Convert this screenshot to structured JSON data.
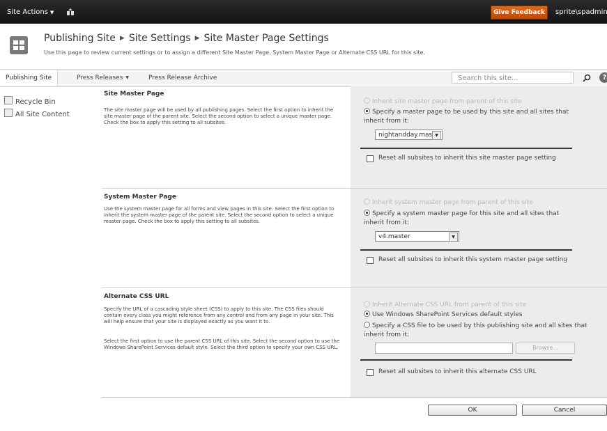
{
  "ribbon": {
    "site_actions": "Site Actions",
    "feedback_label": "Give Feedback",
    "user": "sprite\\spadmin"
  },
  "title": {
    "breadcrumb": [
      "Publishing Site",
      "Site Settings",
      "Site Master Page Settings"
    ],
    "description": "Use this page to review current settings or to assign a different Site Master Page, System Master Page or Alternate CSS URL for this site."
  },
  "topnav": {
    "items": [
      "Publishing Site",
      "Press Releases",
      "Press Release Archive"
    ],
    "search_placeholder": "Search this site..."
  },
  "left_nav": {
    "items": [
      "Recycle Bin",
      "All Site Content"
    ]
  },
  "sections": {
    "site_master": {
      "title": "Site Master Page",
      "description": "The site master page will be used by all publishing pages. Select the first option to inherit the site master page of the parent site. Select the second option to select a unique master page. Check the box to apply this setting to all subsites.",
      "option_inherit": "Inherit site master page from parent of this site",
      "option_specify": "Specify a master page to be used by this site and all sites that inherit from it:",
      "selected_value": "nightandday.master",
      "reset_label": "Reset all subsites to inherit this site master page setting"
    },
    "system_master": {
      "title": "System Master Page",
      "description": "Use the system master page for all forms and view pages in this site. Select the first option to inherit the system master page of the parent site. Select the second option to select a unique master page. Check the box to apply this setting to all subsites.",
      "option_inherit": "Inherit system master page from parent of this site",
      "option_specify": "Specify a system master page for this site and all sites that inherit from it:",
      "selected_value": "v4.master",
      "reset_label": "Reset all subsites to inherit this system master page setting"
    },
    "alternate_css": {
      "title": "Alternate CSS URL",
      "description1": "Specify the URL of a cascading style sheet (CSS) to apply to this site. The CSS files should contain every class you might reference from any control and from any page in your site. This will help ensure that your site is displayed exactly as you want it to.",
      "description2": "Select the first option to use the parent CSS URL of this site. Select the second option to use the Windows SharePoint Services default style. Select the third option to specify your own CSS URL.",
      "option_inherit": "Inherit Alternate CSS URL from parent of this site",
      "option_default": "Use Windows SharePoint Services default styles",
      "option_specify": "Specify a CSS file to be used by this publishing site and all sites that inherit from it:",
      "browse_label": "Browse...",
      "reset_label": "Reset all subsites to inherit this alternate CSS URL"
    }
  },
  "buttons": {
    "ok": "OK",
    "cancel": "Cancel"
  }
}
